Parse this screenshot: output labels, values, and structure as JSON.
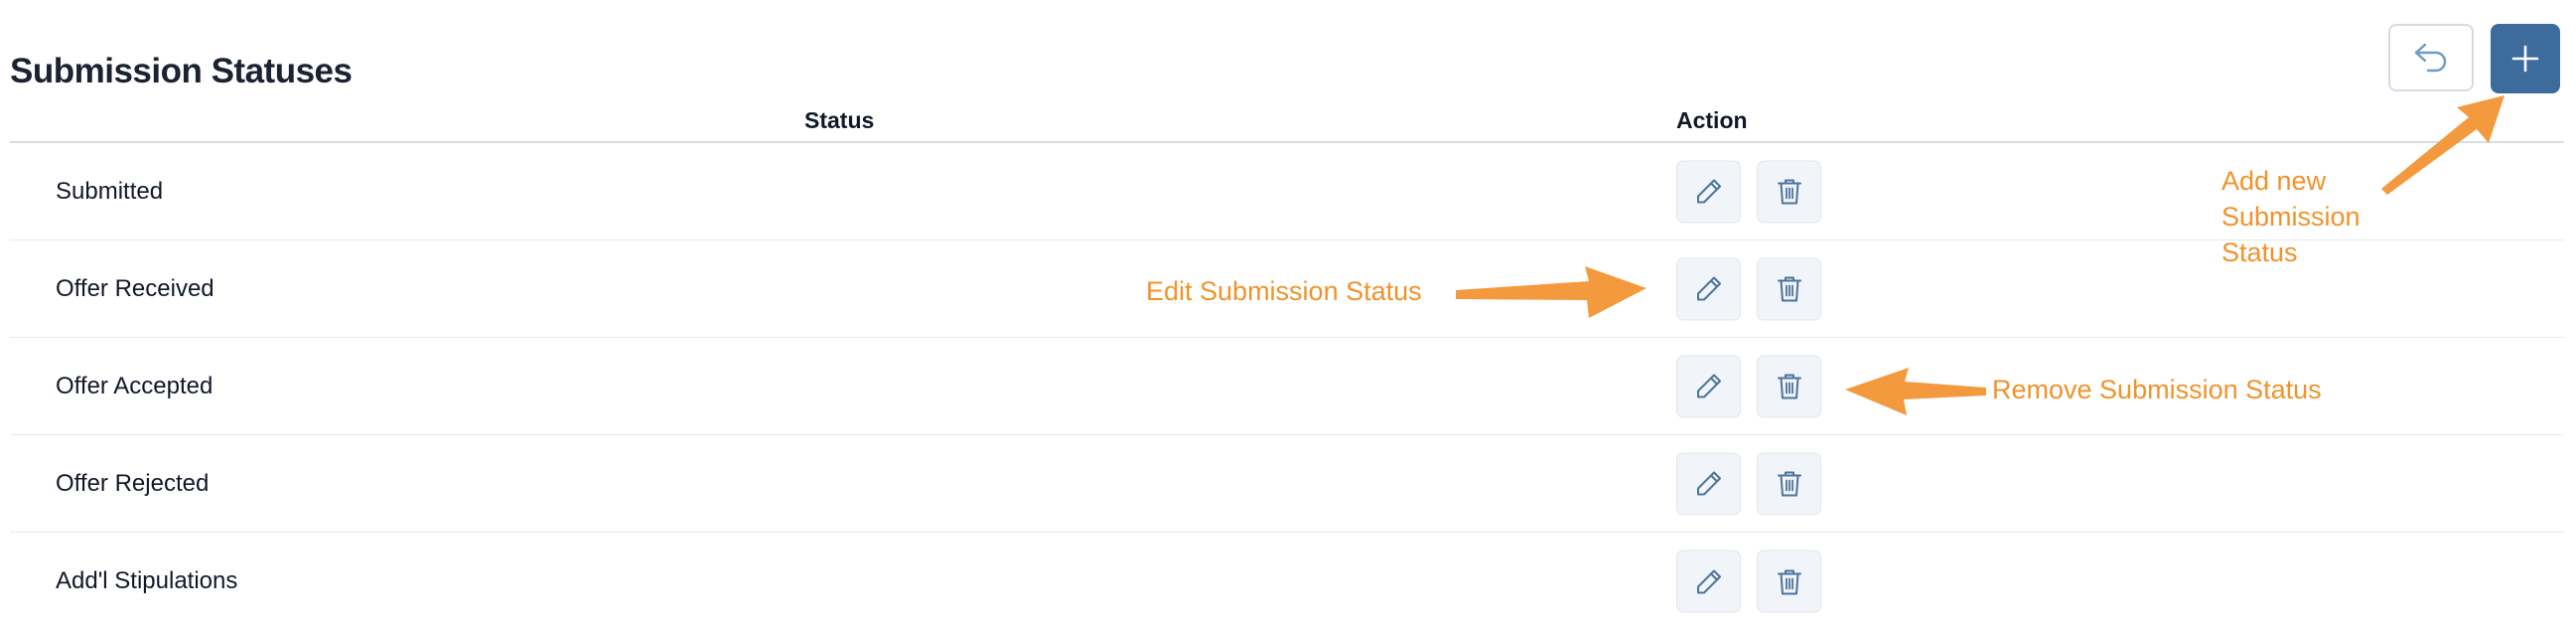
{
  "page": {
    "title": "Submission Statuses"
  },
  "toolbar": {
    "undo_icon": "undo-icon",
    "add_icon": "plus-icon"
  },
  "table": {
    "headers": {
      "status": "Status",
      "action": "Action"
    },
    "rows": [
      {
        "label": "Submitted"
      },
      {
        "label": "Offer Received"
      },
      {
        "label": "Offer Accepted"
      },
      {
        "label": "Offer Rejected"
      },
      {
        "label": "Add'l Stipulations"
      }
    ],
    "row_action_icons": [
      "pencil-icon",
      "trash-icon"
    ]
  },
  "annotations": {
    "edit": "Edit Submission Status",
    "remove": "Remove Submission Status",
    "add_line1": "Add new",
    "add_line2": "Submission",
    "add_line3": "Status"
  },
  "colors": {
    "primary": "#3d6b9b",
    "icon": "#4a74a0",
    "annotation": "#f0932b",
    "button_bg": "#f1f4f8"
  }
}
